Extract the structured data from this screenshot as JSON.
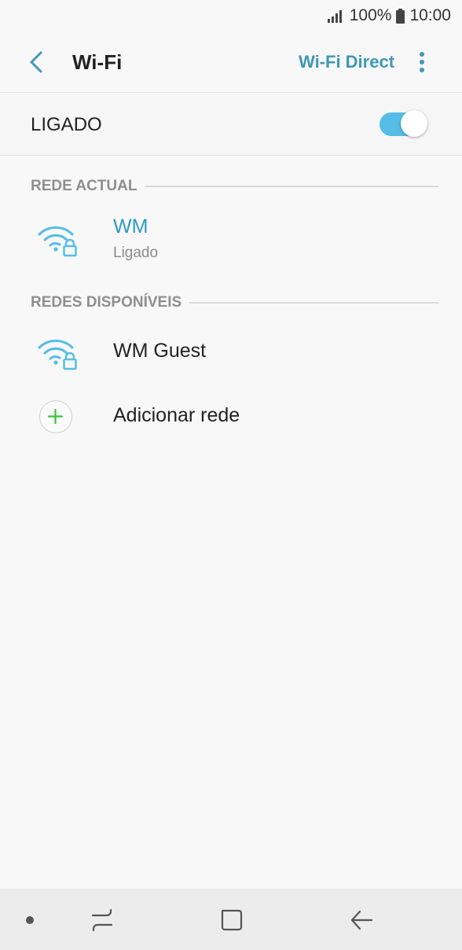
{
  "status_bar": {
    "battery": "100%",
    "time": "10:00"
  },
  "app_bar": {
    "title": "Wi-Fi",
    "wifi_direct_label": "Wi-Fi Direct"
  },
  "master_switch": {
    "label": "LIGADO",
    "on": true
  },
  "current_network": {
    "header": "REDE ACTUAL",
    "name": "WM",
    "status": "Ligado"
  },
  "available_networks": {
    "header": "REDES DISPONÍVEIS",
    "items": [
      {
        "name": "WM Guest"
      }
    ],
    "add_label": "Adicionar rede"
  },
  "colors": {
    "accent": "#3f97b8",
    "connected_name": "#2e9ac4",
    "toggle_on": "#55bde6",
    "add_plus": "#3cc03c",
    "background": "#f8f8f8"
  }
}
